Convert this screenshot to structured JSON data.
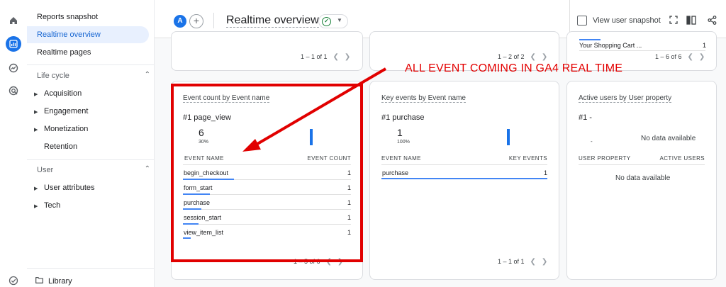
{
  "nav": {
    "reports_snapshot": "Reports snapshot",
    "realtime_overview": "Realtime overview",
    "realtime_pages": "Realtime pages",
    "lifecycle": {
      "label": "Life cycle",
      "items": [
        "Acquisition",
        "Engagement",
        "Monetization",
        "Retention"
      ]
    },
    "user": {
      "label": "User",
      "items": [
        "User attributes",
        "Tech"
      ]
    },
    "library": "Library"
  },
  "header": {
    "avatar_letter": "A",
    "add_comparison": "+",
    "title": "Realtime overview",
    "snapshot_label": "View user snapshot"
  },
  "top_cards": {
    "left_pagination": "1 – 1 of 1",
    "mid_pagination": "1 – 2 of 2",
    "right_item": "Your Shopping Cart ...",
    "right_item_value": "1",
    "right_pagination": "1 – 6 of 6"
  },
  "event_card": {
    "title": "Event count by Event name",
    "rank": "#1  page_view",
    "value": "6",
    "percent": "30%",
    "col_name": "EVENT NAME",
    "col_value": "EVENT COUNT",
    "rows": [
      {
        "name": "begin_checkout",
        "value": "1"
      },
      {
        "name": "form_start",
        "value": "1"
      },
      {
        "name": "purchase",
        "value": "1"
      },
      {
        "name": "session_start",
        "value": "1"
      },
      {
        "name": "view_item_list",
        "value": "1"
      }
    ],
    "pagination": "1 – 5 of 6"
  },
  "key_card": {
    "title": "Key events by Event name",
    "rank": "#1  purchase",
    "value": "1",
    "percent": "100%",
    "col_name": "EVENT NAME",
    "col_value": "KEY EVENTS",
    "rows": [
      {
        "name": "purchase",
        "value": "1"
      }
    ],
    "pagination": "1 – 1 of 1"
  },
  "users_card": {
    "title": "Active users by User property",
    "rank": "#1  -",
    "dash": "-",
    "no_data_top": "No data available",
    "col_name": "USER PROPERTY",
    "col_value": "ACTIVE USERS",
    "no_data_table": "No data available"
  },
  "annotation": {
    "text": "ALL EVENT COMING IN GA4 REAL TIME",
    "color": "#e30000"
  },
  "colors": {
    "accent": "#1a73e8",
    "annotation_red": "#e10000"
  }
}
